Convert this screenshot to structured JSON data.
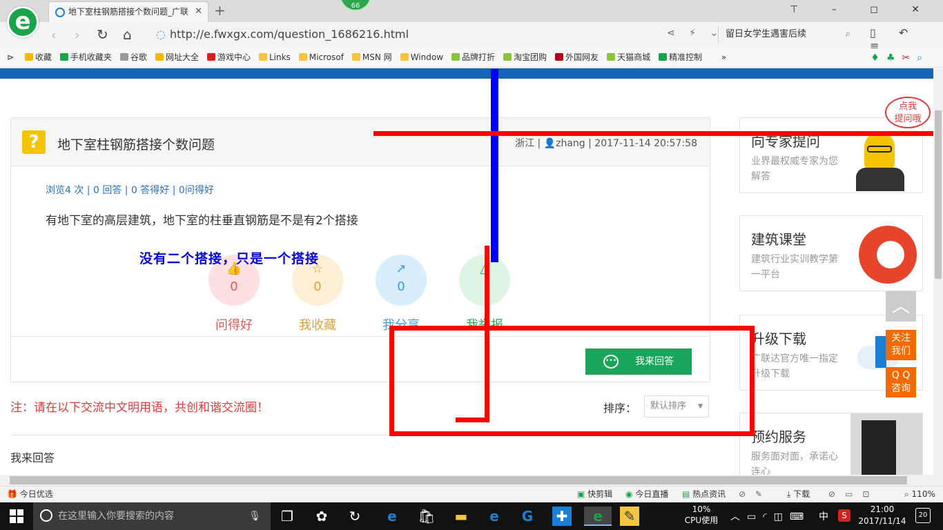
{
  "browser": {
    "logo_letter": "e",
    "tab_title": "地下室柱钢筋搭接个数问题_广联",
    "tab_close": "✕",
    "new_tab": "+",
    "badge": "66",
    "url": "http://e.fwxgx.com/question_1686216.html",
    "search_text": "留日女学生遇害后续",
    "bookmarks": [
      {
        "label": "收藏",
        "color": "#f5b800"
      },
      {
        "label": "手机收藏夹",
        "color": "#19a34a"
      },
      {
        "label": "谷歌",
        "color": "#999999"
      },
      {
        "label": "网址大全",
        "color": "#f5b800"
      },
      {
        "label": "游戏中心",
        "color": "#d62020"
      },
      {
        "label": "Links",
        "color": "#f5c542"
      },
      {
        "label": "Microsof",
        "color": "#f5c542"
      },
      {
        "label": "MSN 网",
        "color": "#f5c542"
      },
      {
        "label": "Window",
        "color": "#f5c542"
      },
      {
        "label": "品牌打折",
        "color": "#8ac43f"
      },
      {
        "label": "淘宝团购",
        "color": "#8ac43f"
      },
      {
        "label": "外国网友",
        "color": "#b00020"
      },
      {
        "label": "天猫商城",
        "color": "#8ac43f"
      },
      {
        "label": "精准控制",
        "color": "#19a34a"
      }
    ],
    "bookmarks_more": "»"
  },
  "question": {
    "icon": "?",
    "title": "地下室柱钢筋搭接个数问题",
    "meta": "浙江 | 👤zhang | 2017-11-14 20:57:58",
    "stats": "浏览4 次 | 0 回答 | 0 答得好 | 0问得好",
    "body": "有地下室的高层建筑，地下室的柱垂直钢筋是不是有2个搭接",
    "actions": [
      {
        "label": "问得好",
        "count": "0",
        "icon": "👍",
        "bg": "#fde0e0",
        "fg": "#e05a5a"
      },
      {
        "label": "我收藏",
        "count": "0",
        "icon": "☆",
        "bg": "#fdefd6",
        "fg": "#e0a030"
      },
      {
        "label": "我分享",
        "count": "0",
        "icon": "↗",
        "bg": "#d8eefc",
        "fg": "#3b9be0"
      },
      {
        "label": "我举报",
        "count": "",
        "icon": "△",
        "bg": "#dff5e3",
        "fg": "#2aa74a"
      }
    ],
    "answer_button": "我来回答"
  },
  "annotation": {
    "handwritten": "没有二个搭接，只是一个搭接"
  },
  "comments": {
    "note": "注：请在以下交流中文明用语，共创和谐交流圈！",
    "sort_label": "排序：",
    "sort_value": "默认排序",
    "my_answer": "我来回答"
  },
  "sidebar": {
    "bubble": "点我\n提问哦",
    "cards": [
      {
        "title": "向专家提问",
        "sub": "业界最权威专家为您解答"
      },
      {
        "title": "建筑课堂",
        "sub": "建筑行业实训教学第一平台"
      },
      {
        "title": "升级下载",
        "sub": "广联达官方唯一指定升级下载"
      },
      {
        "title": "预约服务",
        "sub": "服务面对面，承诺心连心"
      }
    ],
    "float_follow": "关注\n我们",
    "float_qq": "Q Q\n咨询"
  },
  "statusbar": {
    "left": "今日优选",
    "items": [
      "快剪辑",
      "今日直播",
      "热点资讯",
      "下载"
    ],
    "zoom": "110%"
  },
  "taskbar": {
    "search_placeholder": "在这里输入你要搜索的内容",
    "cpu_value": "10%",
    "cpu_label": "CPU使用",
    "ime": "中",
    "time": "21:00",
    "date": "2017/11/14",
    "notifications": "20"
  }
}
